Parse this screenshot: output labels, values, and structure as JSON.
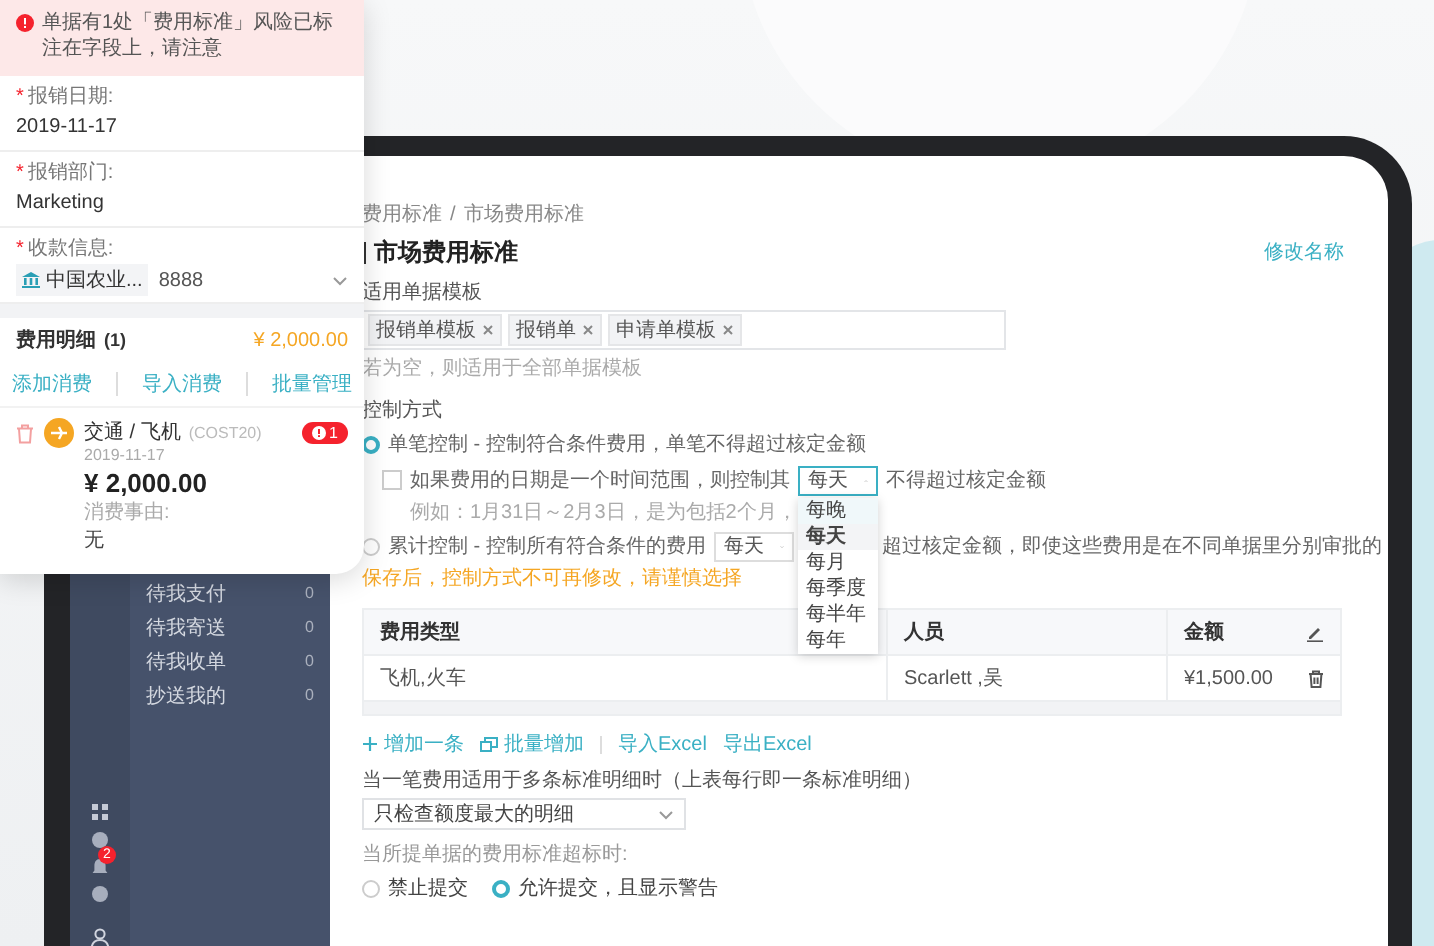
{
  "phone_card": {
    "required_mark": "*",
    "alert": "单据有1处「费用标准」风险已标注在字段上，请注意",
    "fields": [
      {
        "label": "报销日期:",
        "required": true,
        "value": "2019-11-17"
      },
      {
        "label": "报销部门:",
        "required": true,
        "value": "Marketing"
      }
    ],
    "payee": {
      "label": "收款信息:",
      "required": true,
      "bank": "中国农业...",
      "account": "8888"
    },
    "expenses": {
      "title": "费用明细",
      "count": "(1)",
      "total": "¥ 2,000.00",
      "actions": [
        "添加消费",
        "导入消费",
        "批量管理"
      ],
      "items": [
        {
          "category": "交通 / 飞机",
          "code": "(COST20)",
          "date": "2019-11-17",
          "amount": "¥ 2,000.00",
          "reason_label": "消费事由:",
          "reason": "无",
          "badge": "1"
        }
      ]
    }
  },
  "tablet": {
    "sidebar": {
      "menu": [
        {
          "label": "待我支付",
          "count": "0"
        },
        {
          "label": "待我寄送",
          "count": "0"
        },
        {
          "label": "待我收单",
          "count": "0"
        },
        {
          "label": "抄送我的",
          "count": "0"
        }
      ],
      "badge": "2"
    },
    "page": {
      "breadcrumb": [
        "费用标准",
        "市场费用标准"
      ],
      "breadcrumb_separator": "/",
      "title": "市场费用标准",
      "rename_link": "修改名称",
      "templates": {
        "label": "适用单据模板",
        "tags": [
          "报销单模板",
          "报销单",
          "申请单模板"
        ],
        "hint": "若为空，则适用于全部单据模板"
      },
      "control": {
        "label": "控制方式",
        "modes": [
          {
            "kind": "single",
            "selected": true,
            "text": "单笔控制 - 控制符合条件费用，单笔不得超过核定金额",
            "range": {
              "checked": false,
              "text_before": "如果费用的日期是一个时间范围，则控制其",
              "text_after": "不得超过核定金额",
              "example": "例如：1月31日～2月3日，是为包括2个月，",
              "select": {
                "value": "每天",
                "expanded": true,
                "options": [
                  {
                    "label": "每晚",
                    "selected": false,
                    "highlighted": true
                  },
                  {
                    "label": "每天",
                    "selected": true,
                    "highlighted": false
                  },
                  {
                    "label": "每月",
                    "selected": false,
                    "highlighted": false
                  },
                  {
                    "label": "每季度",
                    "selected": false,
                    "highlighted": false
                  },
                  {
                    "label": "每半年",
                    "selected": false,
                    "highlighted": false
                  },
                  {
                    "label": "每年",
                    "selected": false,
                    "highlighted": false
                  }
                ]
              }
            }
          },
          {
            "kind": "cumulative",
            "selected": false,
            "text": "累计控制 - 控制所有符合条件的费用",
            "select": {
              "value": "每天",
              "expanded": false
            },
            "text_after": "超过核定金额，即使这些费用是在不同单据里分别审批的"
          }
        ],
        "warning": "保存后，控制方式不可再修改，请谨慎选择"
      },
      "table": {
        "columns": [
          "费用类型",
          "人员",
          "金额"
        ],
        "rows": [
          [
            "飞机,火车",
            "Scarlett ,吴",
            "¥1,500.00"
          ]
        ]
      },
      "actions": [
        {
          "kind": "add",
          "label": "增加一条"
        },
        {
          "kind": "batch",
          "label": "批量增加"
        },
        {
          "kind": "import",
          "label": "导入Excel"
        },
        {
          "kind": "export",
          "label": "导出Excel"
        }
      ],
      "multi_rule": {
        "label": "当一笔费用适用于多条标准明细时（上表每行即一条标准明细）",
        "value": "只检查额度最大的明细"
      },
      "overflow_rule": {
        "label": "当所提单据的费用标准超标时:",
        "options": [
          {
            "label": "禁止提交",
            "selected": false
          },
          {
            "label": "允许提交，且显示警告",
            "selected": true
          }
        ]
      }
    }
  }
}
